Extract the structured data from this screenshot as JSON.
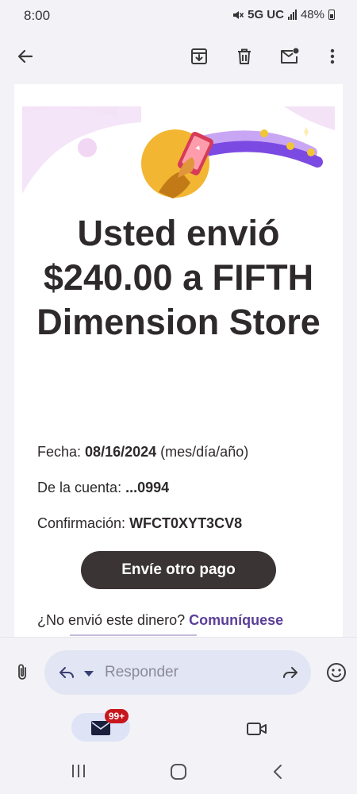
{
  "status_bar": {
    "time": "8:00",
    "network": "5G UC",
    "battery": "48%"
  },
  "toolbar": {
    "icons": [
      "back-arrow-icon",
      "archive-icon",
      "delete-icon",
      "mark-unread-icon",
      "more-vert-icon"
    ]
  },
  "email": {
    "headline": "Usted envió $240.00 a FIFTH Dimension Store",
    "date_label": "Fecha:",
    "date_value": "08/16/2024",
    "date_suffix": "(mes/día/año)",
    "account_label": "De la cuenta:",
    "account_value": "...0994",
    "confirmation_label": "Confirmación:",
    "confirmation_value": "WFCT0XYT3CV8",
    "cta_label": "Envíe otro pago",
    "help_text": "¿No envió este dinero?",
    "help_link": "Comuníquese"
  },
  "reply_bar": {
    "placeholder": "Responder"
  },
  "bottom_nav": {
    "mail_badge": "99+"
  },
  "colors": {
    "accent_purple": "#7b4ae2",
    "link_purple": "#5b3f98",
    "button_dark": "#3b3434",
    "badge_red": "#c8161d",
    "coin_yellow": "#f2b632"
  }
}
